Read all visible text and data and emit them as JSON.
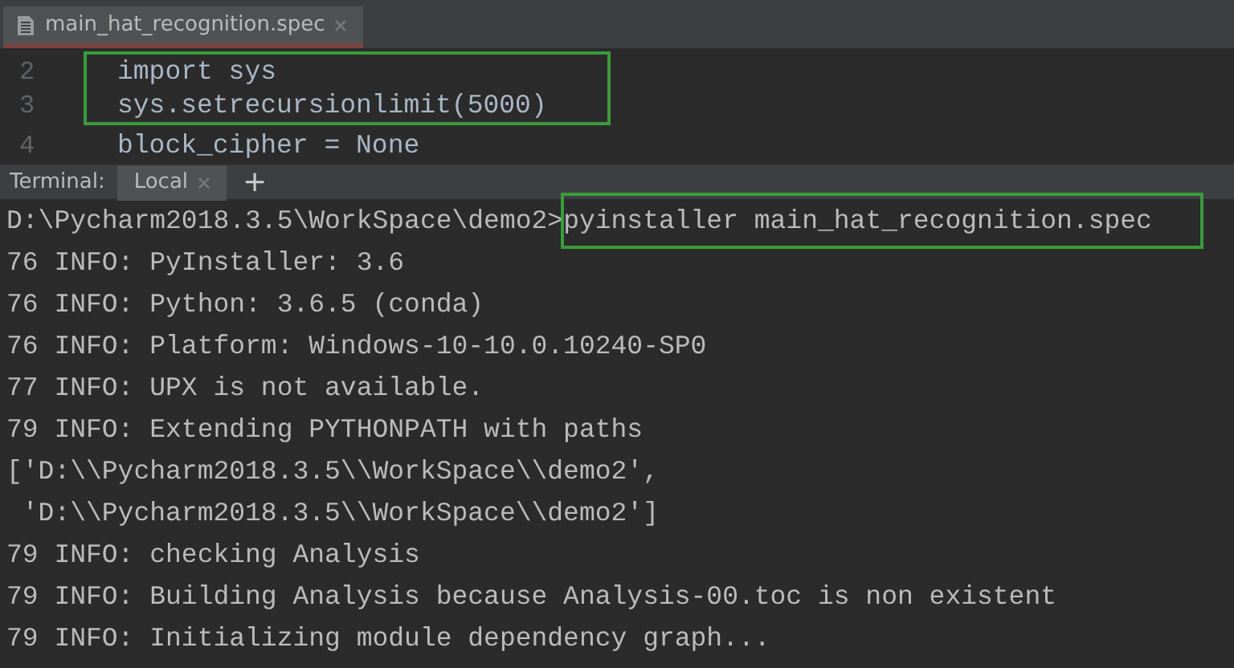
{
  "editor_tabs": [
    {
      "title": "main_hat_recognition.spec",
      "selected": true
    }
  ],
  "editor": {
    "lines": [
      {
        "number": "2",
        "code": "import sys",
        "highlighted": true
      },
      {
        "number": "3",
        "code": "sys.setrecursionlimit(5000)",
        "highlighted": true
      },
      {
        "number": "4",
        "code": "block_cipher = None",
        "highlighted": false
      }
    ]
  },
  "terminal": {
    "label": "Terminal:",
    "tabs": [
      {
        "label": "Local",
        "selected": true
      }
    ],
    "new_tab": "+",
    "lines": [
      {
        "prompt": "D:\\Pycharm2018.3.5\\WorkSpace\\demo2>",
        "text": "pyinstaller main_hat_recognition.spec",
        "highlighted": true
      },
      {
        "text": "76 INFO: PyInstaller: 3.6",
        "highlighted": false
      },
      {
        "text": "76 INFO: Python: 3.6.5 (conda)",
        "highlighted": false
      },
      {
        "text": "76 INFO: Platform: Windows-10-10.0.10240-SP0",
        "highlighted": false
      },
      {
        "text": "77 INFO: UPX is not available.",
        "highlighted": false
      },
      {
        "text": "79 INFO: Extending PYTHONPATH with paths",
        "highlighted": false
      },
      {
        "text": "['D:\\\\Pycharm2018.3.5\\\\WorkSpace\\\\demo2',",
        "highlighted": false
      },
      {
        "text": " 'D:\\\\Pycharm2018.3.5\\\\WorkSpace\\\\demo2']",
        "highlighted": false
      },
      {
        "text": "79 INFO: checking Analysis",
        "highlighted": false
      },
      {
        "text": "79 INFO: Building Analysis because Analysis-00.toc is non existent",
        "highlighted": false
      },
      {
        "text": "79 INFO: Initializing module dependency graph...",
        "highlighted": false
      }
    ]
  }
}
